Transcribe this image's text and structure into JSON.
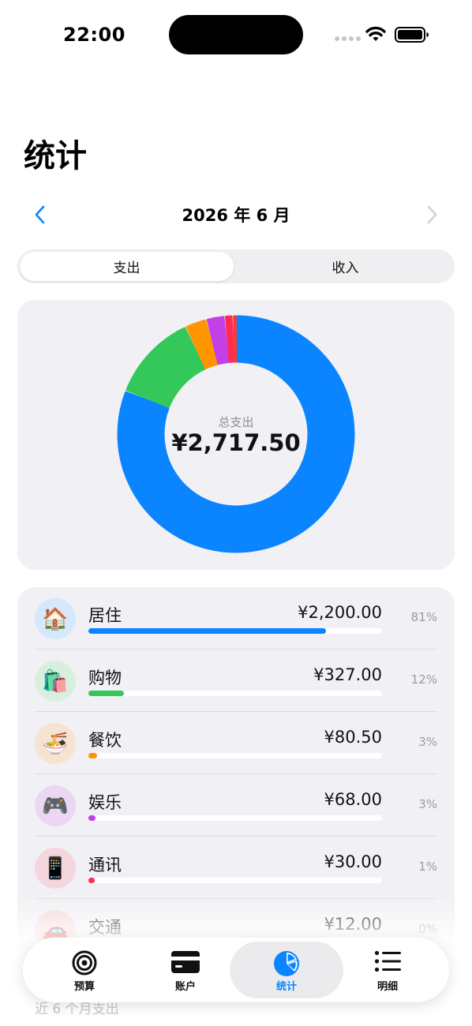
{
  "status": {
    "time": "22:00"
  },
  "page": {
    "title": "统计"
  },
  "month_nav": {
    "label": "2026 年 6 月",
    "prev_icon": "chevron-left-icon",
    "next_icon": "chevron-right-icon"
  },
  "segments": {
    "expense": "支出",
    "income": "收入",
    "selected": "expense"
  },
  "summary": {
    "label": "总支出",
    "value": "¥2,717.50"
  },
  "chart_data": {
    "type": "pie",
    "categories": [
      "居住",
      "购物",
      "餐饮",
      "娱乐",
      "通讯",
      "交通"
    ],
    "values": [
      2200.0,
      327.0,
      80.5,
      68.0,
      30.0,
      12.0
    ],
    "colors": [
      "#0a84ff",
      "#34c759",
      "#ff9500",
      "#c340e6",
      "#ff2d55",
      "#ff3b30"
    ],
    "title": ""
  },
  "categories": [
    {
      "name": "居住",
      "amount": "¥2,200.00",
      "percent": "81%",
      "fraction": 0.81,
      "color": "#0a84ff",
      "icon": "🏠",
      "icon_name": "house-icon",
      "icon_bg": "#d6e8fb"
    },
    {
      "name": "购物",
      "amount": "¥327.00",
      "percent": "12%",
      "fraction": 0.12,
      "color": "#34c759",
      "icon": "🛍️",
      "icon_name": "shopping-bags-icon",
      "icon_bg": "#d8efe0"
    },
    {
      "name": "餐饮",
      "amount": "¥80.50",
      "percent": "3%",
      "fraction": 0.03,
      "color": "#ff9500",
      "icon": "🍜",
      "icon_name": "noodle-bowl-icon",
      "icon_bg": "#f6e3d2"
    },
    {
      "name": "娱乐",
      "amount": "¥68.00",
      "percent": "3%",
      "fraction": 0.025,
      "color": "#c340e6",
      "icon": "🎮",
      "icon_name": "game-controller-icon",
      "icon_bg": "#ecd7f3"
    },
    {
      "name": "通讯",
      "amount": "¥30.00",
      "percent": "1%",
      "fraction": 0.011,
      "color": "#ff2d55",
      "icon": "📱",
      "icon_name": "phone-icon",
      "icon_bg": "#f5d6dd"
    },
    {
      "name": "交通",
      "amount": "¥12.00",
      "percent": "0%",
      "fraction": 0.004,
      "color": "#ff3b30",
      "icon": "🚗",
      "icon_name": "car-icon",
      "icon_bg": "#f5d6d6"
    }
  ],
  "recent_section": {
    "label": "近 6 个月支出"
  },
  "tabs": [
    {
      "label": "预算",
      "icon": "target-icon",
      "active": false
    },
    {
      "label": "账户",
      "icon": "card-icon",
      "active": false
    },
    {
      "label": "统计",
      "icon": "pie-chart-icon",
      "active": true
    },
    {
      "label": "明细",
      "icon": "list-icon",
      "active": false
    }
  ],
  "colors": {
    "accent": "#0a84ff",
    "card_bg": "#f1f1f5",
    "secondary_text": "#8e8e93"
  }
}
